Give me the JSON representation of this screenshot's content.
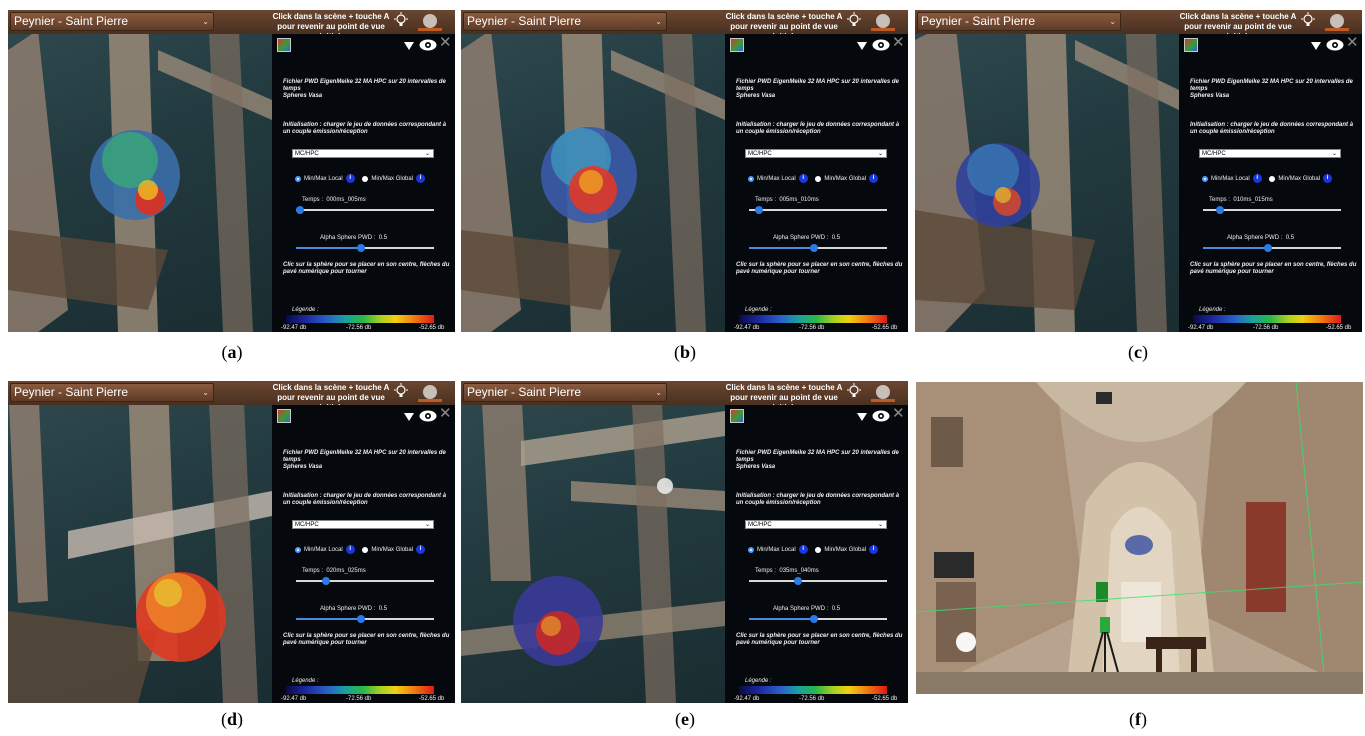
{
  "panels": [
    {
      "label": "a",
      "time": "000ms_005ms",
      "alpha": "0.5"
    },
    {
      "label": "b",
      "time": "005ms_010ms",
      "alpha": "0.5"
    },
    {
      "label": "c",
      "time": "010ms_015ms",
      "alpha": "0.5"
    },
    {
      "label": "d",
      "time": "020ms_025ms",
      "alpha": "0.5"
    },
    {
      "label": "e",
      "time": "035ms_040ms",
      "alpha": "0.5"
    }
  ],
  "caption_f": "f",
  "ui": {
    "location": "Peynier - Saint Pierre",
    "hint": "Click dans la scène + touche A pour revenir au point de vue initial.",
    "file_info": "Fichier PWD EigenMeike 32 MA HPC sur 20 intervalles de temps",
    "file_sub": "Spheres Vasa",
    "init_text": "Initialisation : charger le jeu de données correspondant à un couple émission/réception",
    "dataset": "MC/HPC",
    "radio_local": "Min/Max Local",
    "radio_global": "Min/Max Global",
    "info_glyph": "i",
    "time_label": "Temps :",
    "alpha_label": "Alpha Sphere PWD :",
    "help_text": "Clic sur la sphère pour se placer en son centre, flèches du pavé numérique pour tourner",
    "legend_title": "Légende :",
    "legend_min": "-92.47 db",
    "legend_mid": "-72.56 db",
    "legend_max": "-52.65 db",
    "close_glyph": "✕",
    "chevron_glyph": "⌄"
  },
  "colors": {
    "accent": "#2a7ae8",
    "topbar": "#5a3a26",
    "panel_bg": "#05080c",
    "scene_bg": "#223a3f"
  },
  "sliders": {
    "time_position": [
      0.0,
      0.05,
      0.1,
      0.2,
      0.35
    ],
    "alpha_position": 0.5
  }
}
